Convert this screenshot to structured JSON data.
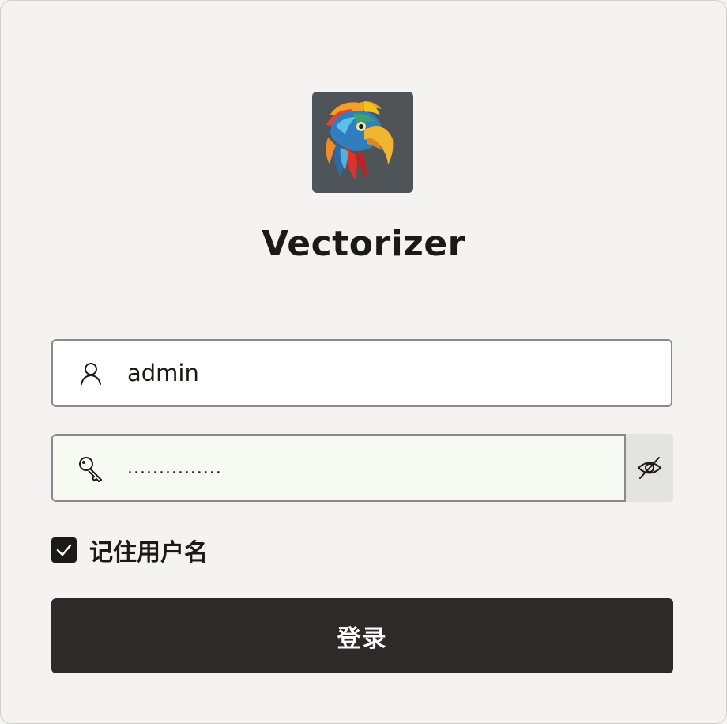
{
  "app": {
    "title": "Vectorizer",
    "logo_icon": "parrot-logo-icon"
  },
  "login_form": {
    "username": {
      "value": "admin",
      "icon": "user-icon"
    },
    "password": {
      "value": "...............",
      "icon": "key-icon",
      "toggle_icon": "eye-off-icon"
    },
    "remember": {
      "label": "记住用户名",
      "checked": true
    },
    "submit_label": "登录"
  },
  "colors": {
    "background": "#f4f3f1",
    "primary_button": "#2e2a27",
    "text": "#1c1a18"
  }
}
